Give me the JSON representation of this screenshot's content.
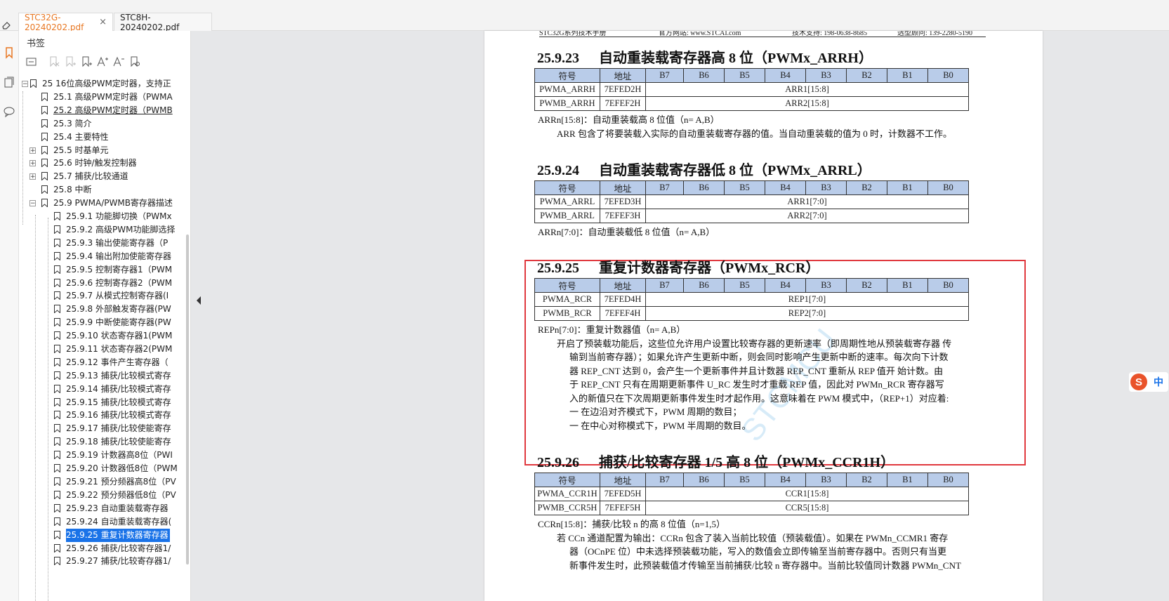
{
  "tabs": [
    {
      "label": "STC32G-20240202.pdf",
      "active": true,
      "color": "#e87722"
    },
    {
      "label": "STC8H-20240202.pdf",
      "active": false,
      "color": "#222222"
    }
  ],
  "sidebar": {
    "title": "书签",
    "tree": [
      {
        "level": 0,
        "label": "25  16位高级PWM定时器，支持正",
        "expander": "-",
        "selected": false,
        "underline": false
      },
      {
        "level": 1,
        "label": "25.1  高级PWM定时器（PWMA",
        "expander": "",
        "selected": false,
        "underline": false
      },
      {
        "level": 1,
        "label": "25.2  高级PWM定时器（PWMB",
        "expander": "",
        "selected": false,
        "underline": true
      },
      {
        "level": 1,
        "label": "25.3  简介",
        "expander": "",
        "selected": false,
        "underline": false
      },
      {
        "level": 1,
        "label": "25.4 主要特性",
        "expander": "",
        "selected": false,
        "underline": false
      },
      {
        "level": 1,
        "label": "25.5 时基单元",
        "expander": "+",
        "selected": false,
        "underline": false
      },
      {
        "level": 1,
        "label": "25.6 时钟/触发控制器",
        "expander": "+",
        "selected": false,
        "underline": false
      },
      {
        "level": 1,
        "label": "25.7 捕获/比较通道",
        "expander": "+",
        "selected": false,
        "underline": false
      },
      {
        "level": 1,
        "label": "25.8 中断",
        "expander": "",
        "selected": false,
        "underline": false
      },
      {
        "level": 1,
        "label": "25.9  PWMA/PWMB寄存器描述",
        "expander": "-",
        "selected": false,
        "underline": false
      },
      {
        "level": 2,
        "label": "25.9.1 功能脚切换（PWMx",
        "expander": "",
        "selected": false,
        "underline": false
      },
      {
        "level": 2,
        "label": "25.9.2 高级PWM功能脚选择",
        "expander": "",
        "selected": false,
        "underline": false
      },
      {
        "level": 2,
        "label": "25.9.3  输出使能寄存器（P",
        "expander": "",
        "selected": false,
        "underline": false
      },
      {
        "level": 2,
        "label": "25.9.4  输出附加使能寄存器",
        "expander": "",
        "selected": false,
        "underline": false
      },
      {
        "level": 2,
        "label": "25.9.5  控制寄存器1（PWM",
        "expander": "",
        "selected": false,
        "underline": false
      },
      {
        "level": 2,
        "label": "25.9.6 控制寄存器2（PWM",
        "expander": "",
        "selected": false,
        "underline": false
      },
      {
        "level": 2,
        "label": "25.9.7  从模式控制寄存器(I",
        "expander": "",
        "selected": false,
        "underline": false
      },
      {
        "level": 2,
        "label": "25.9.8  外部触发寄存器(PW",
        "expander": "",
        "selected": false,
        "underline": false
      },
      {
        "level": 2,
        "label": "25.9.9  中断使能寄存器(PW",
        "expander": "",
        "selected": false,
        "underline": false
      },
      {
        "level": 2,
        "label": "25.9.10 状态寄存器1(PWM",
        "expander": "",
        "selected": false,
        "underline": false
      },
      {
        "level": 2,
        "label": "25.9.11 状态寄存器2(PWM",
        "expander": "",
        "selected": false,
        "underline": false
      },
      {
        "level": 2,
        "label": "25.9.12  事件产生寄存器（",
        "expander": "",
        "selected": false,
        "underline": false
      },
      {
        "level": 2,
        "label": "25.9.13  捕获/比较模式寄存",
        "expander": "",
        "selected": false,
        "underline": false
      },
      {
        "level": 2,
        "label": "25.9.14 捕获/比较模式寄存",
        "expander": "",
        "selected": false,
        "underline": false
      },
      {
        "level": 2,
        "label": "25.9.15  捕获/比较模式寄存",
        "expander": "",
        "selected": false,
        "underline": false
      },
      {
        "level": 2,
        "label": "25.9.16  捕获/比较模式寄存",
        "expander": "",
        "selected": false,
        "underline": false
      },
      {
        "level": 2,
        "label": "25.9.17  捕获/比较使能寄存",
        "expander": "",
        "selected": false,
        "underline": false
      },
      {
        "level": 2,
        "label": "25.9.18 捕获/比较使能寄存",
        "expander": "",
        "selected": false,
        "underline": false
      },
      {
        "level": 2,
        "label": "25.9.19  计数器高8位（PWI",
        "expander": "",
        "selected": false,
        "underline": false
      },
      {
        "level": 2,
        "label": "25.9.20 计数器低8位（PWM",
        "expander": "",
        "selected": false,
        "underline": false
      },
      {
        "level": 2,
        "label": "25.9.21  预分频器高8位（PV",
        "expander": "",
        "selected": false,
        "underline": false
      },
      {
        "level": 2,
        "label": "25.9.22  预分频器低8位（PV",
        "expander": "",
        "selected": false,
        "underline": false
      },
      {
        "level": 2,
        "label": "25.9.23  自动重装载寄存器",
        "expander": "",
        "selected": false,
        "underline": false
      },
      {
        "level": 2,
        "label": "25.9.24 自动重装载寄存器(",
        "expander": "",
        "selected": false,
        "underline": false
      },
      {
        "level": 2,
        "label": "25.9.25 重复计数器寄存器",
        "expander": "",
        "selected": true,
        "underline": false
      },
      {
        "level": 2,
        "label": "25.9.26 捕获/比较寄存器1/",
        "expander": "",
        "selected": false,
        "underline": false
      },
      {
        "level": 2,
        "label": "25.9.27  捕获/比较寄存器1/",
        "expander": "",
        "selected": false,
        "underline": false
      }
    ]
  },
  "doc": {
    "header": {
      "left": "STC32G系列技术手册",
      "mid": "官方网站: www.STCAI.com",
      "right1": "技术支持: 198-0638-8685",
      "right2": "选型顾问: 139-2280-5190"
    },
    "table_header": [
      "符号",
      "地址",
      "B7",
      "B6",
      "B5",
      "B4",
      "B3",
      "B2",
      "B1",
      "B0"
    ],
    "sections": [
      {
        "heading_num": "25.9.23",
        "heading_text": "自动重装载寄存器高 8 位（PWMx_ARRH）",
        "rows": [
          [
            "PWMA_ARRH",
            "7EFED2H",
            "ARR1[15:8]"
          ],
          [
            "PWMB_ARRH",
            "7EFEF2H",
            "ARR2[15:8]"
          ]
        ],
        "lines": [
          "ARRn[15:8]：自动重装载高 8 位值（n= A,B）",
          "ARR 包含了将要装载入实际的自动重装载寄存器的值。当自动重装载的值为 0 时，计数器不工作。"
        ]
      },
      {
        "heading_num": "25.9.24",
        "heading_text": "自动重装载寄存器低 8 位（PWMx_ARRL）",
        "rows": [
          [
            "PWMA_ARRL",
            "7EFED3H",
            "ARR1[7:0]"
          ],
          [
            "PWMB_ARRL",
            "7EFEF3H",
            "ARR2[7:0]"
          ]
        ],
        "lines": [
          "ARRn[7:0]：自动重装载低 8 位值（n= A,B）"
        ]
      },
      {
        "heading_num": "25.9.25",
        "heading_text": "重复计数器寄存器（PWMx_RCR）",
        "rows": [
          [
            "PWMA_RCR",
            "7EFED4H",
            "REP1[7:0]"
          ],
          [
            "PWMB_RCR",
            "7EFEF4H",
            "REP2[7:0]"
          ]
        ],
        "lines": [
          "REPn[7:0]：重复计数器值（n= A,B）",
          "开启了预装载功能后，这些位允许用户设置比较寄存器的更新速率（即周期性地从预装载寄存器 传",
          "输到当前寄存器）；如果允许产生更新中断，则会同时影响产生更新中断的速率。每次向下计数",
          "器 REP_CNT 达到 0，会产生一个更新事件并且计数器 REP_CNT 重新从 REP 值开  始计数。由",
          "于 REP_CNT 只有在周期更新事件 U_RC 发生时才重载 REP 值，因此对 PWMn_RCR 寄存器写",
          "入的新值只在下次周期更新事件发生时才起作用。这意味着在 PWM 模式中，（REP+1）对应着:",
          "一  在边沿对齐模式下，PWM 周期的数目；",
          "一  在中心对称模式下，PWM 半周期的数目。"
        ]
      },
      {
        "heading_num": "25.9.26",
        "heading_text": "捕获/比较寄存器 1/5 高 8 位（PWMx_CCR1H）",
        "rows": [
          [
            "PWMA_CCR1H",
            "7EFED5H",
            "CCR1[15:8]"
          ],
          [
            "PWMB_CCR5H",
            "7EFEF5H",
            "CCR5[15:8]"
          ]
        ],
        "lines": [
          "CCRn[15:8]：捕获/比较 n 的高 8 位值（n=1,5）",
          "若 CCn 通道配置为输出：CCRn 包含了装入当前比较值（预装载值）。如果在 PWMn_CCMR1 寄存",
          "器（OCnPE 位）中未选择预装载功能，写入的数值会立即传输至当前寄存器中。否则只有当更",
          "新事件发生时，此预装载值才传输至当前捕获/比较 n 寄存器中。当前比较值同计数器 PWMn_CNT"
        ]
      }
    ],
    "watermark": "STCMCU"
  },
  "ime": {
    "label": "中",
    "logo": "S"
  }
}
